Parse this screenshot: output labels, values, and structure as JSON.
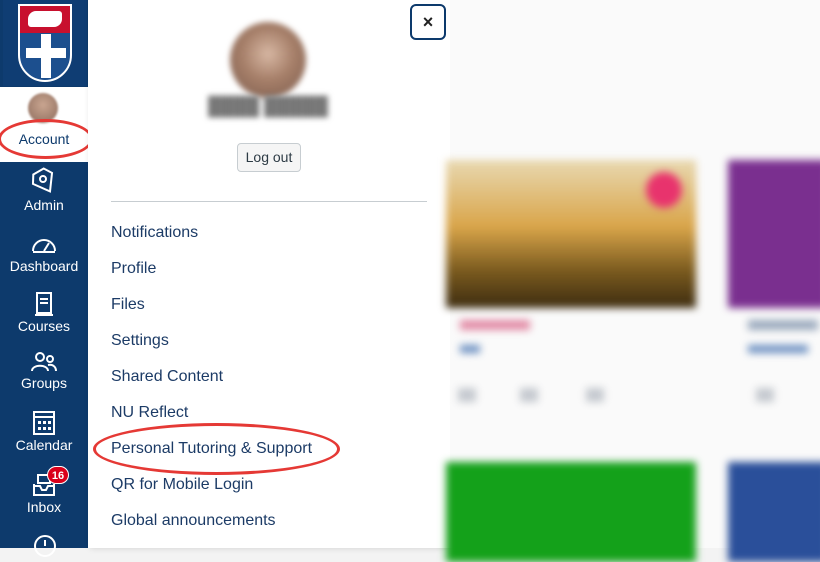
{
  "nav": {
    "account_label": "Account",
    "items": [
      {
        "label": "Admin",
        "icon": "admin-shield-icon"
      },
      {
        "label": "Dashboard",
        "icon": "dashboard-gauge-icon"
      },
      {
        "label": "Courses",
        "icon": "courses-book-icon"
      },
      {
        "label": "Groups",
        "icon": "groups-people-icon"
      },
      {
        "label": "Calendar",
        "icon": "calendar-icon"
      },
      {
        "label": "Inbox",
        "icon": "inbox-tray-icon"
      }
    ],
    "inbox_badge": "16"
  },
  "tray": {
    "logout_label": "Log out",
    "close_label": "×",
    "menu": [
      "Notifications",
      "Profile",
      "Files",
      "Settings",
      "Shared Content",
      "NU Reflect",
      "Personal Tutoring & Support",
      "QR for Mobile Login",
      "Global announcements"
    ]
  },
  "colors": {
    "nav_bg": "#0d3a6c",
    "link": "#1c3b66",
    "highlight": "#e53935",
    "badge": "#d9001b"
  }
}
